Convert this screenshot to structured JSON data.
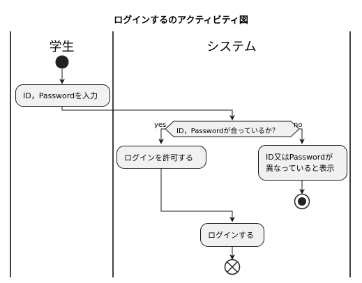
{
  "title": "ログインするのアクティビティ図",
  "swimlanes": [
    {
      "name": "学生"
    },
    {
      "name": "システム"
    }
  ],
  "activities": {
    "enter_credentials": "ID，Passwordを入力",
    "allow_login": "ログインを許可する",
    "show_error_line1": "ID又はPasswordが",
    "show_error_line2": "異なっていると表示",
    "login": "ログインする"
  },
  "decision": {
    "question": "ID，Passwordが合っているか？",
    "yes_label": "yes",
    "no_label": "no"
  }
}
